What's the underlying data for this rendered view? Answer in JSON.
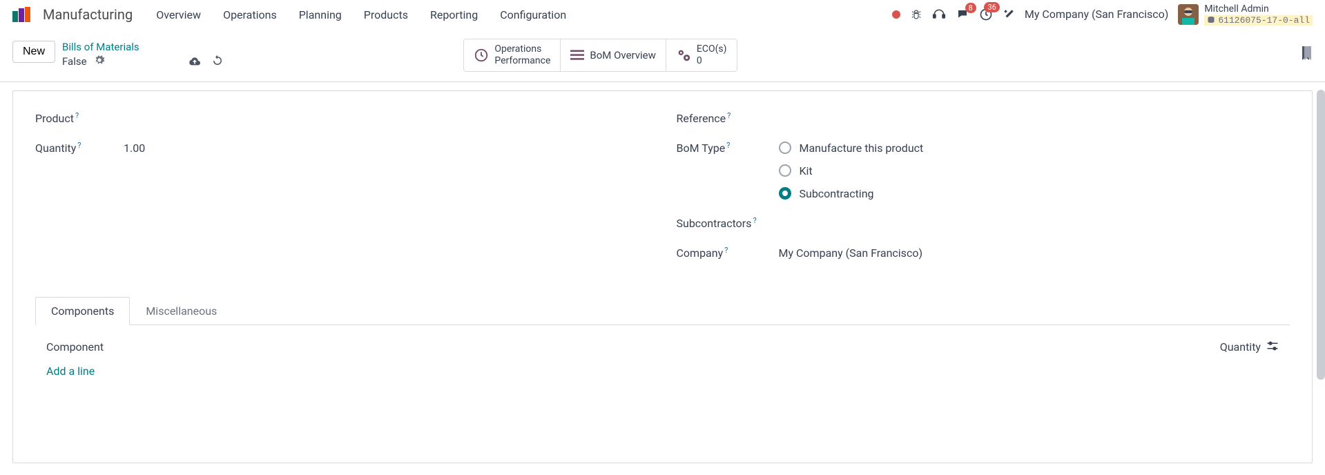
{
  "app": {
    "name": "Manufacturing"
  },
  "nav": {
    "items": [
      "Overview",
      "Operations",
      "Planning",
      "Products",
      "Reporting",
      "Configuration"
    ]
  },
  "header": {
    "company": "My Company (San Francisco)",
    "user": "Mitchell Admin",
    "db": "61126075-17-0-all",
    "msg_badge": "8",
    "activity_badge": "36"
  },
  "controls": {
    "new_label": "New",
    "breadcrumb_parent": "Bills of Materials",
    "breadcrumb_current": "False"
  },
  "stat_buttons": {
    "ops_line1": "Operations",
    "ops_line2": "Performance",
    "bom_overview": "BoM Overview",
    "eco_line1": "ECO(s)",
    "eco_line2": "0"
  },
  "form": {
    "left": {
      "product_label": "Product",
      "quantity_label": "Quantity",
      "quantity_value": "1.00"
    },
    "right": {
      "reference_label": "Reference",
      "bom_type_label": "BoM Type",
      "bom_type_options": [
        "Manufacture this product",
        "Kit",
        "Subcontracting"
      ],
      "bom_type_selected": 2,
      "subcontractors_label": "Subcontractors",
      "company_label": "Company",
      "company_value": "My Company (San Francisco)"
    }
  },
  "tabs": {
    "items": [
      "Components",
      "Miscellaneous"
    ],
    "active": 0,
    "columns": {
      "component": "Component",
      "quantity": "Quantity"
    },
    "add_line": "Add a line"
  }
}
